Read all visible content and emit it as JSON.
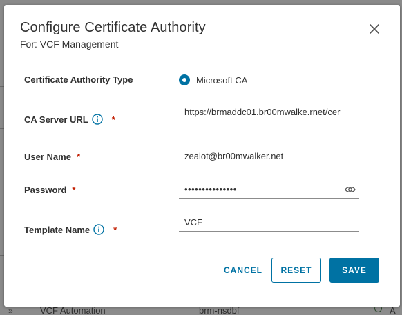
{
  "modal": {
    "title": "Configure Certificate Authority",
    "subtitle": "For: VCF Management"
  },
  "form": {
    "ca_type": {
      "label": "Certificate Authority Type",
      "option_label": "Microsoft CA",
      "selected": true
    },
    "ca_server_url": {
      "label": "CA Server URL",
      "value": "https://brmaddc01.br00mwalke.rnet/cer",
      "required_mark": "*"
    },
    "user_name": {
      "label": "User Name",
      "value": "zealot@br00mwalker.net",
      "required_mark": "*"
    },
    "password": {
      "label": "Password",
      "value": "•••••••••••••••",
      "required_mark": "*"
    },
    "template_name": {
      "label": "Template Name",
      "value": "VCF",
      "required_mark": "*"
    }
  },
  "buttons": {
    "cancel": "CANCEL",
    "reset": "RESET",
    "save": "SAVE"
  },
  "background": {
    "row_name": "VCF Automation",
    "row_host": "brm-nsdbf",
    "row_trailing": "A",
    "chevrons": "»"
  },
  "colors": {
    "accent": "#0072a3",
    "required": "#c21d00",
    "text": "#313131"
  },
  "icons": [
    "close-icon",
    "info-icon",
    "eye-icon",
    "radio-selected-icon"
  ]
}
